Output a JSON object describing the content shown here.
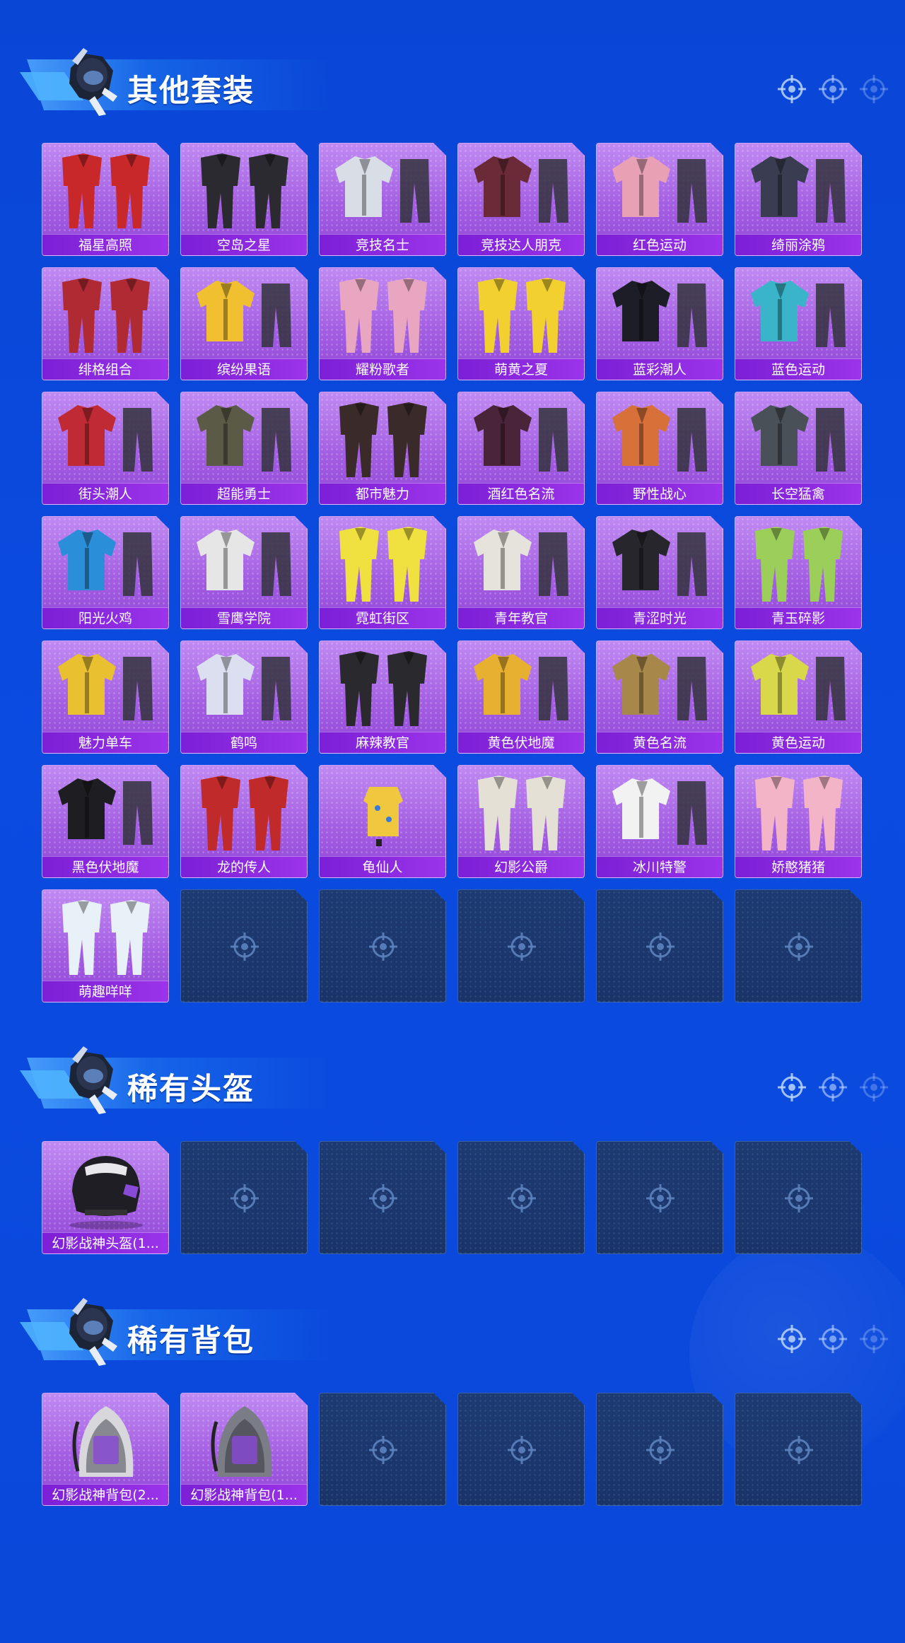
{
  "sections": [
    {
      "title": "其他套装",
      "icons": [
        "crosshair-icon",
        "crosshair-icon",
        "crosshair-icon"
      ],
      "columns": 6,
      "slots": 42,
      "items": [
        {
          "label": "福星高照",
          "color": "#c8282a",
          "type": "suit"
        },
        {
          "label": "空岛之星",
          "color": "#2a2a30",
          "type": "suit"
        },
        {
          "label": "竞技名士",
          "color": "#d9dde6",
          "type": "jacket"
        },
        {
          "label": "竞技达人朋克",
          "color": "#6a2a38",
          "type": "jacket"
        },
        {
          "label": "红色运动",
          "color": "#e8a0b4",
          "type": "jacket"
        },
        {
          "label": "绮丽涂鸦",
          "color": "#3a3d52",
          "type": "jacket"
        },
        {
          "label": "绯格组合",
          "color": "#b02a34",
          "type": "suit"
        },
        {
          "label": "缤纷果语",
          "color": "#f0c030",
          "type": "jacket"
        },
        {
          "label": "耀粉歌者",
          "color": "#e8a6c0",
          "type": "suit"
        },
        {
          "label": "萌黄之夏",
          "color": "#f2d030",
          "type": "suit"
        },
        {
          "label": "蓝彩潮人",
          "color": "#1c1d26",
          "type": "jacket"
        },
        {
          "label": "蓝色运动",
          "color": "#3ab4c8",
          "type": "jacket"
        },
        {
          "label": "街头潮人",
          "color": "#c02a34",
          "type": "jacket"
        },
        {
          "label": "超能勇士",
          "color": "#5a5a46",
          "type": "jacket"
        },
        {
          "label": "都市魅力",
          "color": "#3a2a2a",
          "type": "suit"
        },
        {
          "label": "酒红色名流",
          "color": "#4a2438",
          "type": "jacket"
        },
        {
          "label": "野性战心",
          "color": "#d8703a",
          "type": "jacket"
        },
        {
          "label": "长空猛禽",
          "color": "#4a5058",
          "type": "jacket"
        },
        {
          "label": "阳光火鸡",
          "color": "#2a8ed8",
          "type": "jacket"
        },
        {
          "label": "雪鹰学院",
          "color": "#e6e6e6",
          "type": "jacket"
        },
        {
          "label": "霓虹街区",
          "color": "#f0e040",
          "type": "suit"
        },
        {
          "label": "青年教官",
          "color": "#e6e2dc",
          "type": "jacket"
        },
        {
          "label": "青涩时光",
          "color": "#26262c",
          "type": "jacket"
        },
        {
          "label": "青玉碎影",
          "color": "#9ccf5a",
          "type": "suit"
        },
        {
          "label": "魅力单车",
          "color": "#e8c030",
          "type": "jacket"
        },
        {
          "label": "鹤鸣",
          "color": "#dcdff0",
          "type": "jacket"
        },
        {
          "label": "麻辣教官",
          "color": "#2a2a2e",
          "type": "suit"
        },
        {
          "label": "黄色伏地魔",
          "color": "#e8b030",
          "type": "jacket"
        },
        {
          "label": "黄色名流",
          "color": "#a8874a",
          "type": "jacket"
        },
        {
          "label": "黄色运动",
          "color": "#d8d84a",
          "type": "jacket"
        },
        {
          "label": "黑色伏地魔",
          "color": "#1e1e22",
          "type": "jacket"
        },
        {
          "label": "龙的传人",
          "color": "#c02a2a",
          "type": "suit"
        },
        {
          "label": "龟仙人",
          "color": "#f0c840",
          "type": "small"
        },
        {
          "label": "幻影公爵",
          "color": "#e4e0d6",
          "type": "suit"
        },
        {
          "label": "冰川特警",
          "color": "#f2f2f2",
          "type": "jacket"
        },
        {
          "label": "娇憨猪猪",
          "color": "#f4b4c8",
          "type": "suit"
        },
        {
          "label": "萌趣咩咩",
          "color": "#e8f0f8",
          "type": "suit"
        }
      ]
    },
    {
      "title": "稀有头盔",
      "icons": [
        "crosshair-icon",
        "crosshair-icon",
        "crosshair-icon"
      ],
      "columns": 6,
      "slots": 6,
      "items": [
        {
          "label": "幻影战神头盔(1...",
          "color": "#1e1e24",
          "type": "helmet"
        }
      ]
    },
    {
      "title": "稀有背包",
      "icons": [
        "crosshair-icon",
        "crosshair-icon",
        "crosshair-icon"
      ],
      "columns": 6,
      "slots": 6,
      "items": [
        {
          "label": "幻影战神背包(2...",
          "color": "#d8d8dc",
          "type": "backpack"
        },
        {
          "label": "幻影战神背包(1...",
          "color": "#7a7d86",
          "type": "backpack"
        }
      ]
    }
  ]
}
